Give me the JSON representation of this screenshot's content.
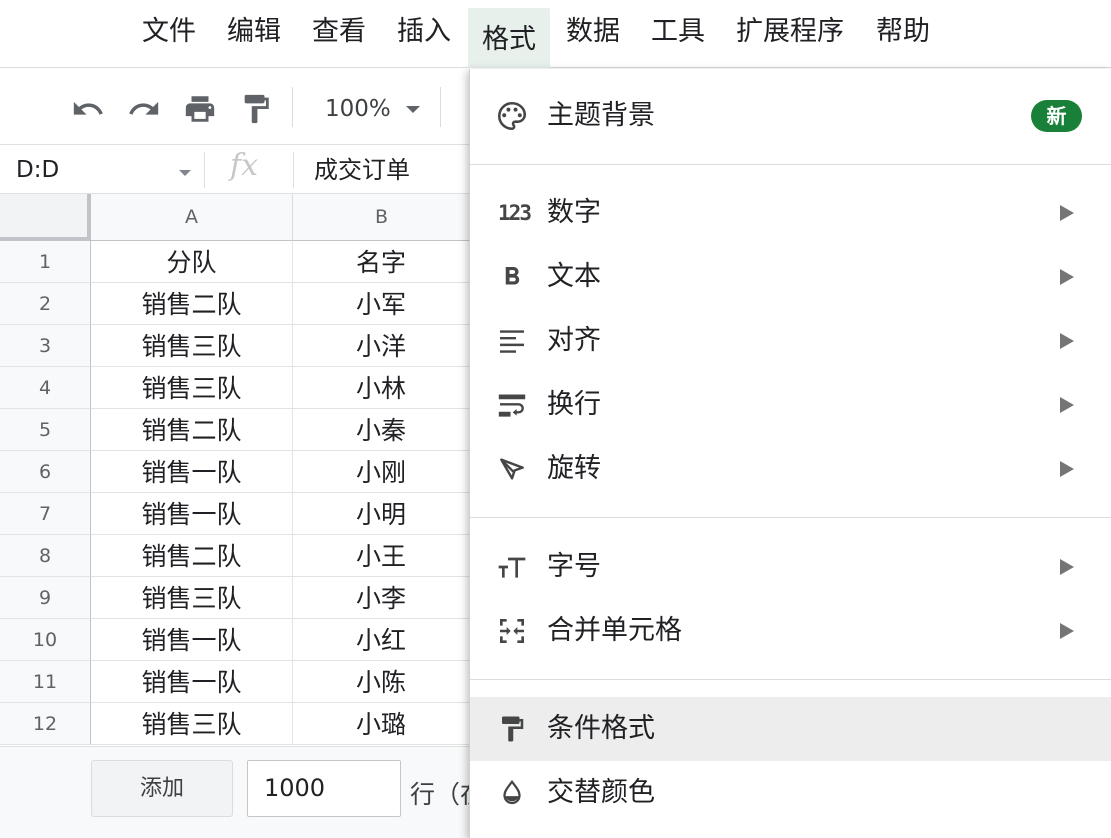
{
  "menubar": {
    "items": [
      {
        "label": "文件"
      },
      {
        "label": "编辑"
      },
      {
        "label": "查看"
      },
      {
        "label": "插入"
      },
      {
        "label": "格式",
        "active": true
      },
      {
        "label": "数据"
      },
      {
        "label": "工具"
      },
      {
        "label": "扩展程序"
      },
      {
        "label": "帮助"
      }
    ]
  },
  "toolbar": {
    "zoom": "100%",
    "icons": [
      "undo-icon",
      "redo-icon",
      "print-icon",
      "paint-format-icon"
    ]
  },
  "formula_bar": {
    "name_box": "D:D",
    "fx": "fx",
    "value": "成交订单"
  },
  "grid": {
    "columns": [
      "A",
      "B"
    ],
    "rows": [
      {
        "num": "1",
        "a": "分队",
        "b": "名字"
      },
      {
        "num": "2",
        "a": "销售二队",
        "b": "小军"
      },
      {
        "num": "3",
        "a": "销售三队",
        "b": "小洋"
      },
      {
        "num": "4",
        "a": "销售三队",
        "b": "小林"
      },
      {
        "num": "5",
        "a": "销售二队",
        "b": "小秦"
      },
      {
        "num": "6",
        "a": "销售一队",
        "b": "小刚"
      },
      {
        "num": "7",
        "a": "销售一队",
        "b": "小明"
      },
      {
        "num": "8",
        "a": "销售二队",
        "b": "小王"
      },
      {
        "num": "9",
        "a": "销售三队",
        "b": "小李"
      },
      {
        "num": "10",
        "a": "销售一队",
        "b": "小红"
      },
      {
        "num": "11",
        "a": "销售一队",
        "b": "小陈"
      },
      {
        "num": "12",
        "a": "销售三队",
        "b": "小璐"
      }
    ]
  },
  "bottom_bar": {
    "add_label": "添加",
    "rows_value": "1000",
    "rows_suffix": "行（在"
  },
  "format_menu": {
    "items": [
      {
        "label": "主题背景",
        "icon": "palette-icon",
        "badge": "新"
      },
      {
        "label": "数字",
        "icon": "number-format-icon",
        "submenu": true
      },
      {
        "label": "文本",
        "icon": "bold-icon",
        "submenu": true
      },
      {
        "label": "对齐",
        "icon": "align-icon",
        "submenu": true
      },
      {
        "label": "换行",
        "icon": "wrap-icon",
        "submenu": true
      },
      {
        "label": "旋转",
        "icon": "rotate-icon",
        "submenu": true
      },
      {
        "label": "字号",
        "icon": "font-size-icon",
        "submenu": true
      },
      {
        "label": "合并单元格",
        "icon": "merge-icon",
        "submenu": true
      },
      {
        "label": "条件格式",
        "icon": "paint-roller-icon",
        "highlighted": true
      },
      {
        "label": "交替颜色",
        "icon": "fill-drop-icon"
      }
    ],
    "number_icon_text": "123",
    "colors": {
      "badge": "#188038",
      "hover": "#ededed",
      "menu_active": "#e8f0ec"
    }
  }
}
